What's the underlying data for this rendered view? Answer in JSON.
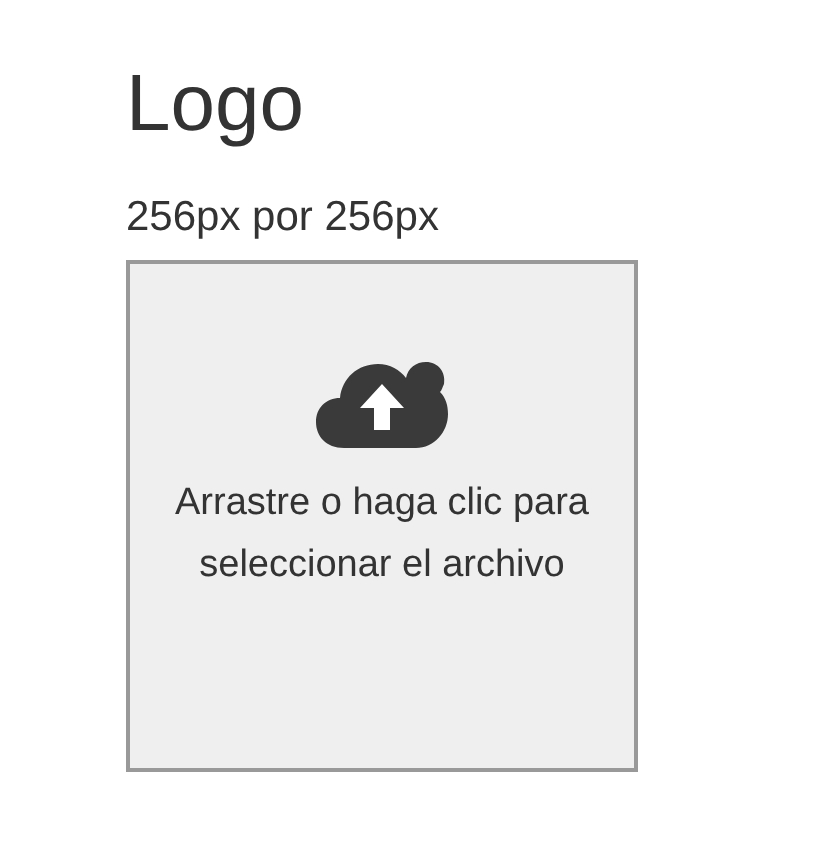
{
  "title": "Logo",
  "size_hint": "256px por 256px",
  "dropzone": {
    "label": "Arrastre o haga clic para seleccionar el archivo"
  }
}
